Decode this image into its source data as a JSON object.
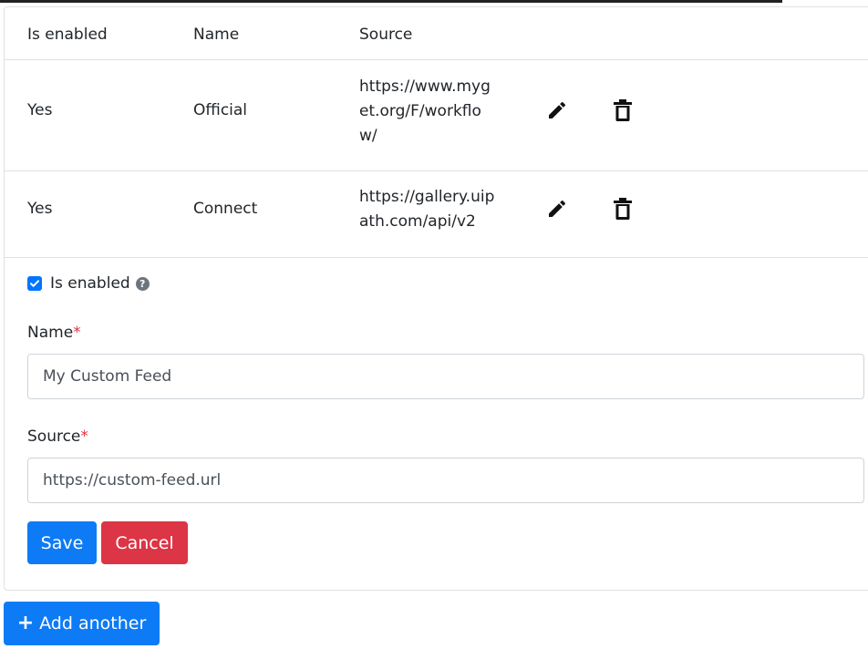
{
  "table": {
    "headers": [
      "Is enabled",
      "Name",
      "Source"
    ],
    "rows": [
      {
        "enabled": "Yes",
        "name": "Official",
        "source": "https://www.myget.org/F/workflow/"
      },
      {
        "enabled": "Yes",
        "name": "Connect",
        "source": "https://gallery.uipath.com/api/v2"
      }
    ]
  },
  "form": {
    "enabled_label": "Is enabled",
    "enabled_checked": true,
    "help_glyph": "?",
    "name_label": "Name",
    "name_value": "My Custom Feed",
    "source_label": "Source",
    "source_value": "https://custom-feed.url",
    "required_mark": "*",
    "save_label": "Save",
    "cancel_label": "Cancel"
  },
  "add_another": {
    "glyph": "+",
    "label": "Add another"
  },
  "icons": {
    "edit": "pencil-icon",
    "delete": "trash-icon",
    "help": "question-circle-icon",
    "add": "plus-icon"
  },
  "colors": {
    "primary": "#0d7bf5",
    "danger": "#dc3545",
    "required": "#dc3545",
    "checkbox": "#0075ff"
  }
}
